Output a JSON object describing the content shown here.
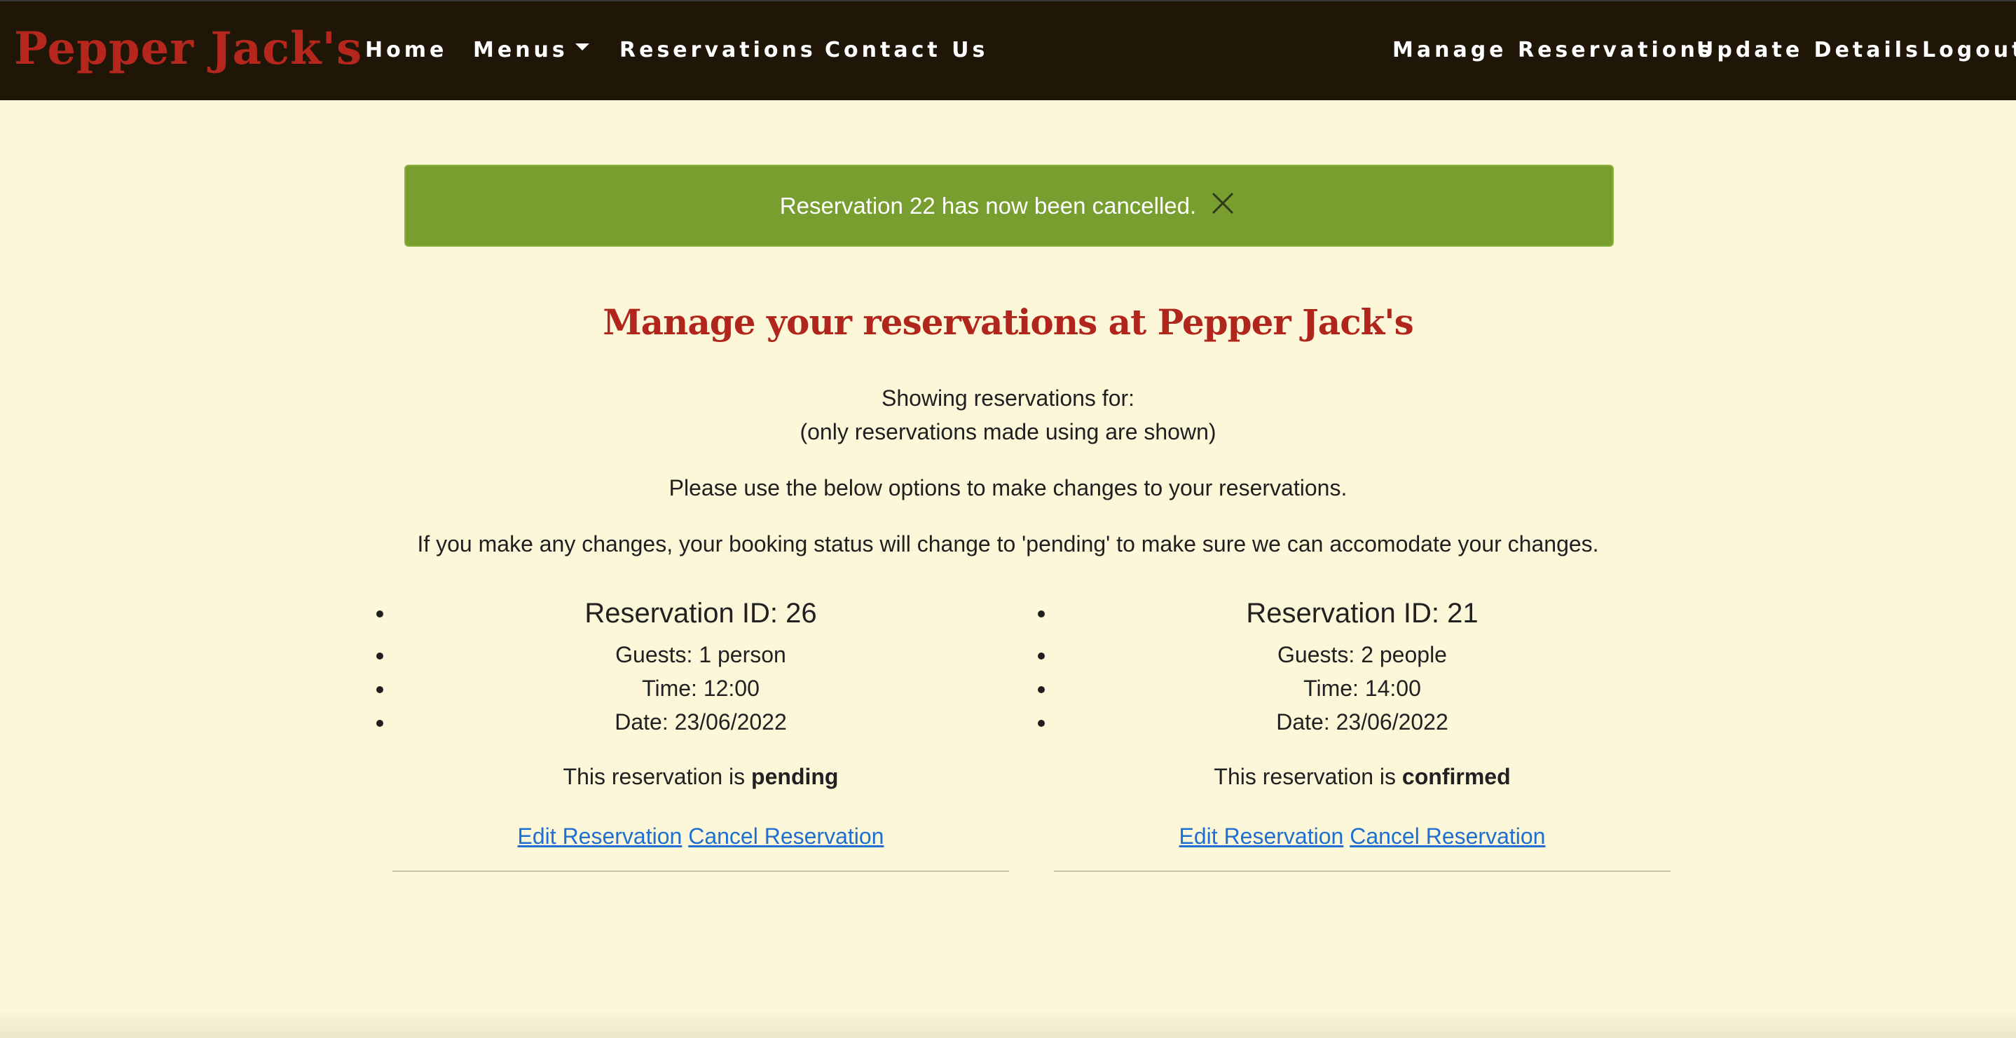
{
  "nav": {
    "brand": "Pepper Jack's",
    "links": {
      "home": "Home",
      "menus": "Menus",
      "reservations": "Reservations",
      "contact": "Contact Us",
      "manage": "Manage Reservations",
      "update": "Update Details",
      "logout": "Logout"
    }
  },
  "alert": {
    "message": "Reservation 22 has now been cancelled.",
    "color": "#789e2f"
  },
  "main": {
    "heading": "Manage your reservations at Pepper Jack's",
    "showing": "Showing reservations for:",
    "note": "(only reservations made using are shown)",
    "instructions": "Please use the below options to make changes to your reservations.",
    "warning": "If you make any changes, your booking status will change to 'pending' to make sure we can accomodate your changes."
  },
  "reservations": [
    {
      "title": "Reservation ID: 26",
      "guests": "Guests: 1 person",
      "time": "Time: 12:00",
      "date": "Date: 23/06/2022",
      "status_prefix": "This reservation is",
      "status": "pending",
      "edit_label": "Edit Reservation",
      "cancel_label": "Cancel Reservation"
    },
    {
      "title": "Reservation ID: 21",
      "guests": "Guests: 2 people",
      "time": "Time: 14:00",
      "date": "Date: 23/06/2022",
      "status_prefix": "This reservation is",
      "status": "confirmed",
      "edit_label": "Edit Reservation",
      "cancel_label": "Cancel Reservation"
    }
  ],
  "colors": {
    "navbar": "#201607",
    "brand": "#b5271d",
    "background": "#fcf7d9",
    "link": "#1f6fd1"
  }
}
